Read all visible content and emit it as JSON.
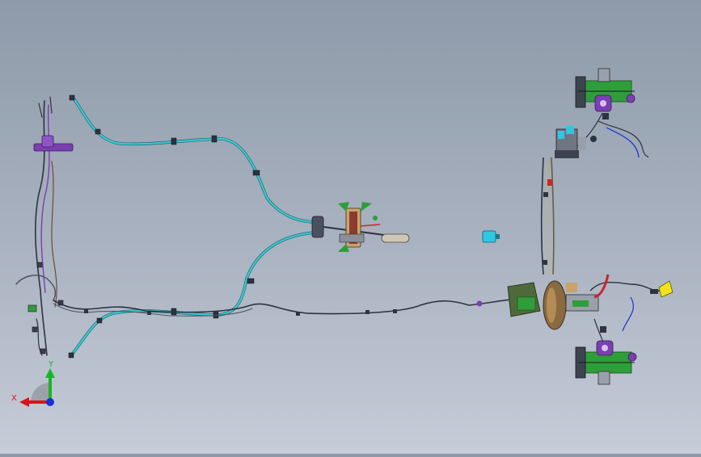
{
  "triad": {
    "x_label": "X",
    "y_label": "Y",
    "colors": {
      "x": "#d9141b",
      "y": "#19b526",
      "z": "#1a2fd6"
    }
  },
  "colors": {
    "cable": "#3ec8cf",
    "cable_outline": "#1c6b74",
    "line": "#2d3340",
    "caliper": "#7a3fb0",
    "bracket_green": "#2f9e3a",
    "sensor": "#2fc8e0",
    "connector_yellow": "#f2e21a",
    "hose_red": "#c8262a"
  }
}
